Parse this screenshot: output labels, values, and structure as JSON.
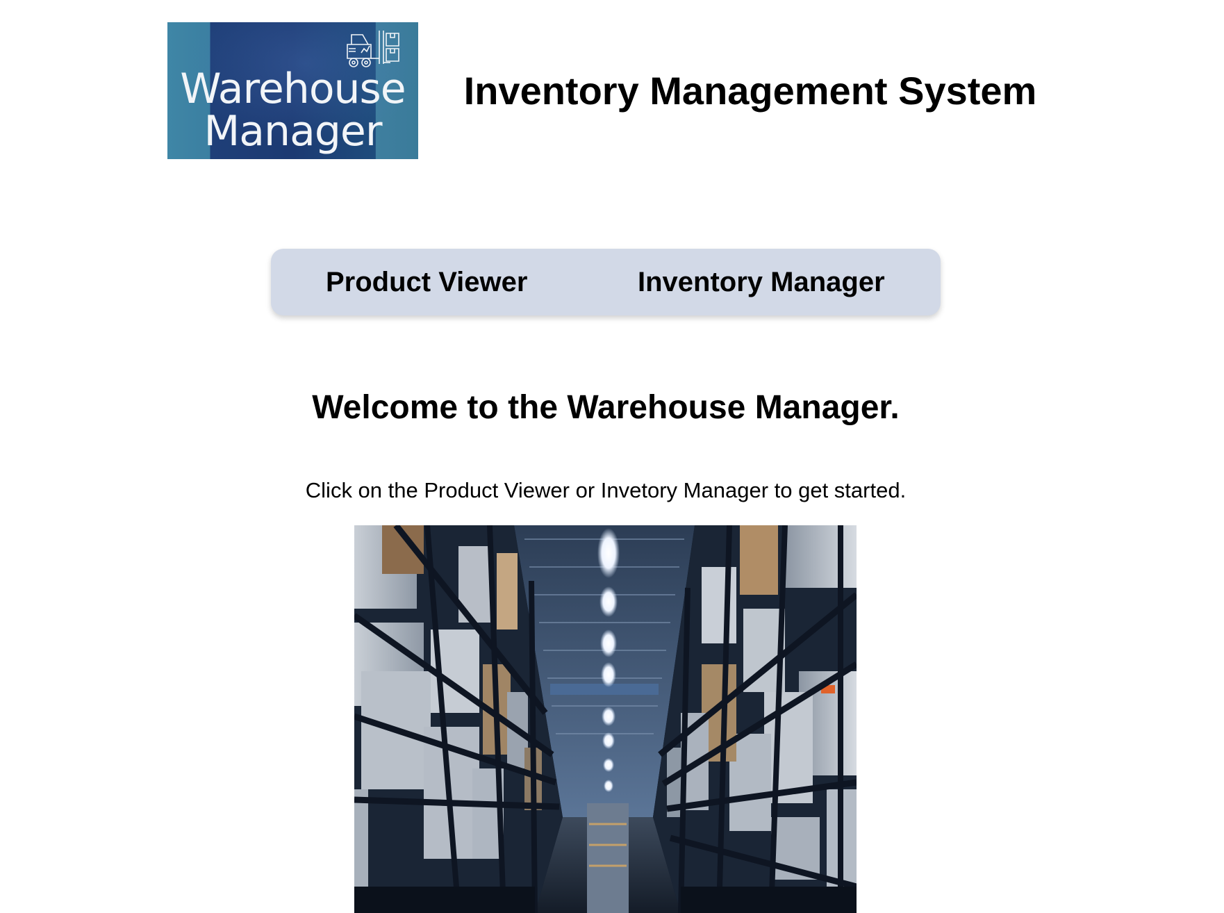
{
  "header": {
    "logo": {
      "line1": "Warehouse",
      "line2": "Manager",
      "icon": "forklift-boxes-icon",
      "colors": {
        "panel": "#1c3a72",
        "edge": "#3f86a6",
        "text": "#f2f5f8"
      }
    },
    "title": "Inventory Management System"
  },
  "nav": {
    "items": [
      {
        "label": "Product Viewer"
      },
      {
        "label": "Inventory Manager"
      }
    ],
    "background": "#d2d9e7"
  },
  "main": {
    "heading": "Welcome to the Warehouse Manager.",
    "instructions": "Click on the Product Viewer or Invetory Manager to get started.",
    "image": {
      "subject": "warehouse-aisle-photo"
    }
  }
}
